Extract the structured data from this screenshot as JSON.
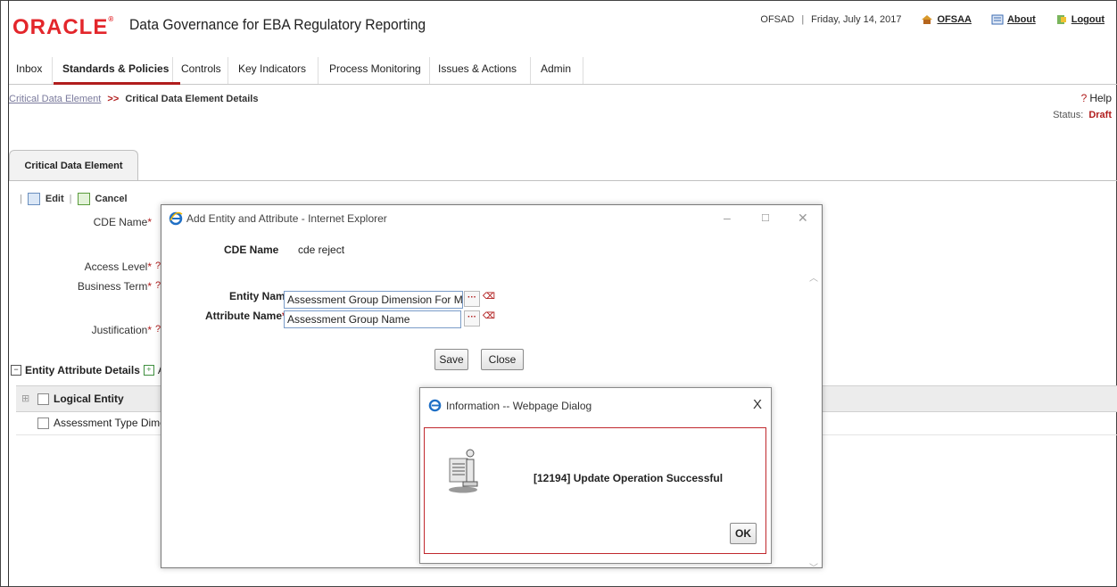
{
  "header": {
    "logo": "ORACLE",
    "app_title": "Data Governance for EBA Regulatory Reporting",
    "user": "OFSAD",
    "separator": "|",
    "date": "Friday, July 14, 2017",
    "links": [
      "OFSAA",
      "About",
      "Logout"
    ]
  },
  "nav": {
    "items": [
      "Inbox",
      "Standards & Policies",
      "Controls",
      "Key Indicators",
      "Process Monitoring",
      "Issues & Actions",
      "Admin"
    ]
  },
  "breadcrumb": {
    "parent": "Critical Data Element",
    "separator": ">>",
    "current": "Critical Data Element Details"
  },
  "help": {
    "mark": "?",
    "label": "Help"
  },
  "status": {
    "label": "Status:",
    "value": "Draft"
  },
  "tab": {
    "label": "Critical Data Element"
  },
  "toolbar": {
    "edit": "Edit",
    "cancel": "Cancel",
    "bar": "|"
  },
  "form": {
    "cde_name_label": "CDE Name",
    "access_level_label": "Access Level",
    "business_term_label": "Business Term",
    "justification_label": "Justification",
    "required_mark": "*",
    "help_mark": "?"
  },
  "grid": {
    "section_title": "Entity Attribute Details",
    "section_action": "A",
    "column_logical_entity": "Logical Entity",
    "rows": [
      "Assessment Type Dime"
    ]
  },
  "add_dialog": {
    "title": "Add Entity and Attribute - Internet Explorer",
    "cde_name_label": "CDE Name",
    "cde_name_value": "cde reject",
    "entity_name_label": "Entity Name",
    "entity_name_value": "Assessment Group Dimension For Mu",
    "attribute_name_label": "Attribute Name",
    "attribute_name_value": "Assessment Group Name",
    "required_mark": "*",
    "lookup_glyph": "···",
    "save": "Save",
    "close": "Close"
  },
  "info_dialog": {
    "title": "Information -- Webpage Dialog",
    "message": "[12194] Update Operation Successful",
    "ok": "OK",
    "close_glyph": "X"
  },
  "colors": {
    "brand_red": "#e3262b",
    "accent_red": "#b11d1d",
    "ie_blue": "#1f6fc5"
  }
}
